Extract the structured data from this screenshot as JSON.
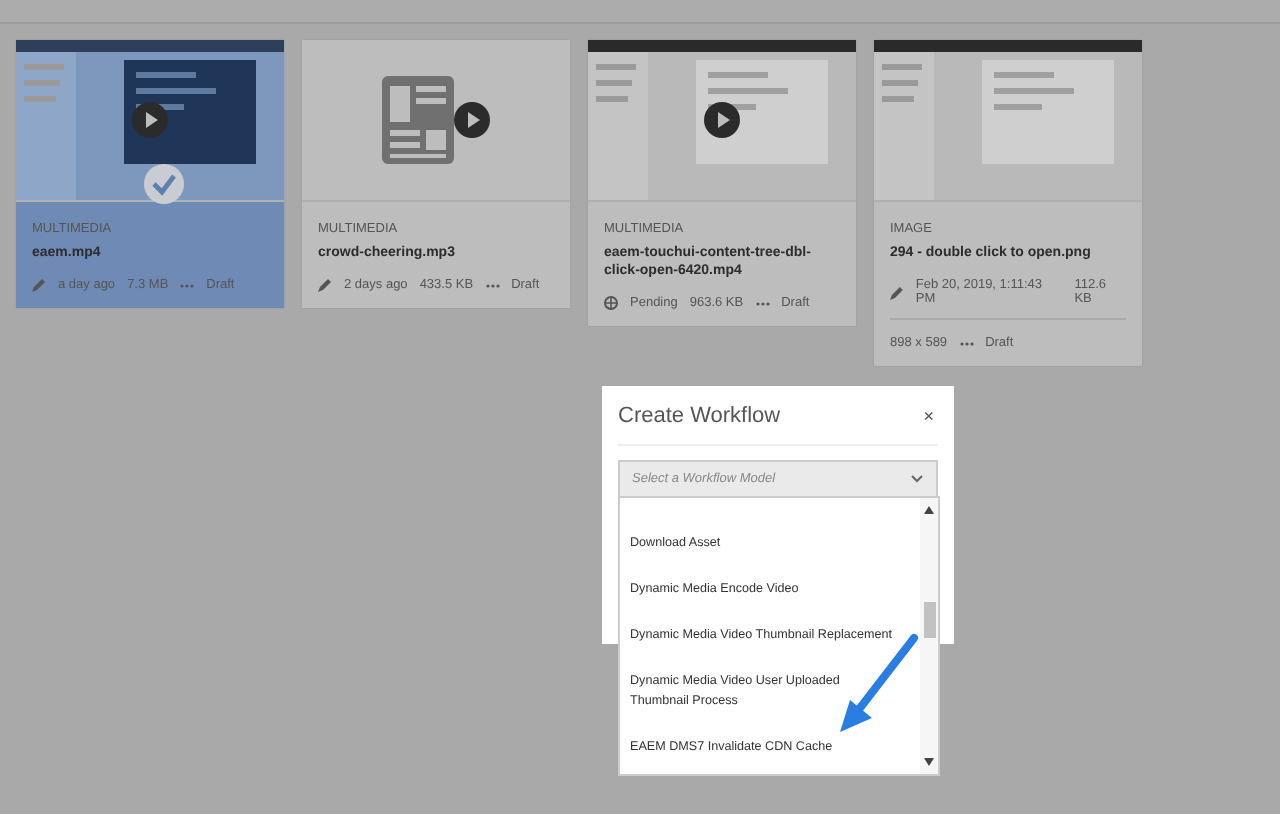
{
  "assets": [
    {
      "type": "MULTIMEDIA",
      "name": "eaem.mp4",
      "selected": true,
      "thumbnail": {
        "kind": "screen"
      },
      "play": true,
      "status_icon": {
        "kind": "edit"
      },
      "status": "a day ago",
      "size": "7.3 MB",
      "workflow": "Draft"
    },
    {
      "type": "MULTIMEDIA",
      "name": "crowd-cheering.mp3",
      "selected": false,
      "thumbnail": {
        "kind": "document"
      },
      "play": true,
      "status_icon": {
        "kind": "edit"
      },
      "status": "2 days ago",
      "size": "433.5 KB",
      "workflow": "Draft"
    },
    {
      "type": "MULTIMEDIA",
      "name": "eaem-touchui-content-tree-dbl-click-open-6420.mp4",
      "selected": false,
      "thumbnail": {
        "kind": "screen"
      },
      "play": true,
      "status_icon": {
        "kind": "processing"
      },
      "status": "Pending",
      "size": "963.6 KB",
      "workflow": "Draft"
    },
    {
      "type": "IMAGE",
      "name": "294 - double click to open.png",
      "selected": false,
      "thumbnail": {
        "kind": "screen"
      },
      "play": false,
      "status_icon": {
        "kind": "edit"
      },
      "status": "Feb 20, 2019, 1:11:43 PM",
      "size": "112.6 KB",
      "dimensions": "898 x 589",
      "workflow": "Draft"
    }
  ],
  "dialog": {
    "title": "Create Workflow",
    "close": "×",
    "select": {
      "placeholder": "Select a Workflow Model",
      "expanded": true
    },
    "options": [
      "Download Asset",
      "Dynamic Media Encode Video",
      "Dynamic Media Video Thumbnail Replacement",
      "Dynamic Media Video User Uploaded Thumbnail Process",
      "EAEM DMS7 Invalidate CDN Cache"
    ]
  }
}
